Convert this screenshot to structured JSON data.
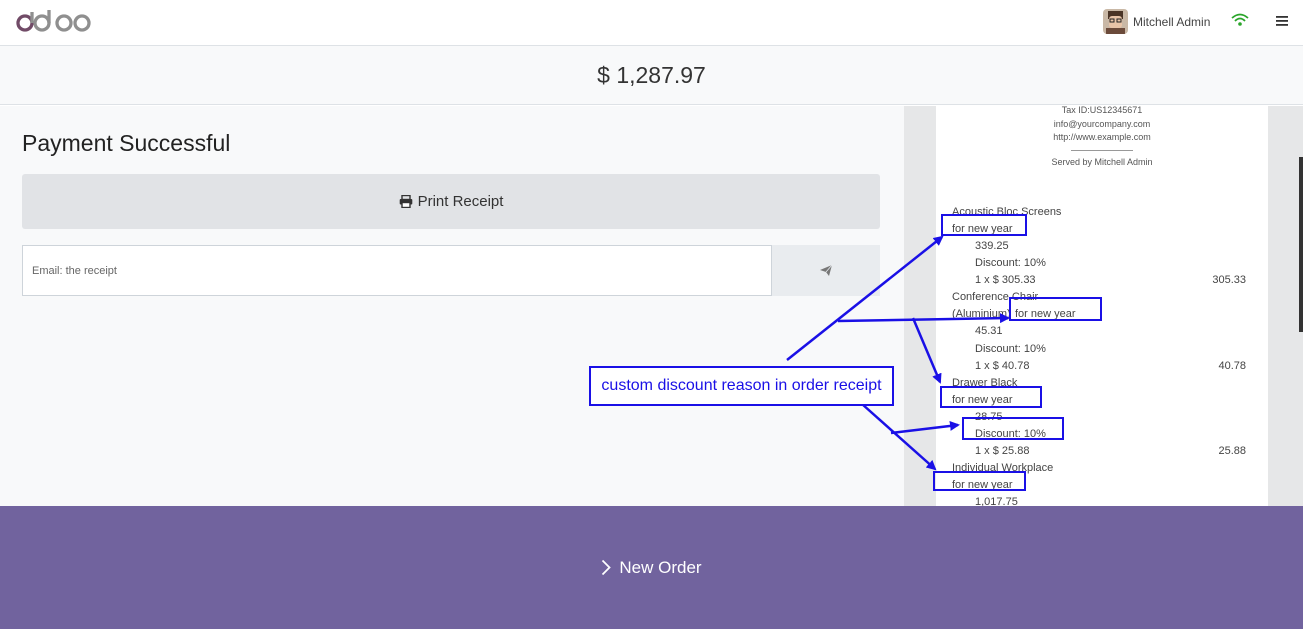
{
  "navbar": {
    "logo_text": "odoo",
    "user_name": "Mitchell Admin",
    "wifi_icon": "wifi-icon",
    "menu_icon": "hamburger-icon"
  },
  "total": "$ 1,287.97",
  "payment": {
    "title": "Payment Successful",
    "print_label": "Print Receipt",
    "email_placeholder": "Email: the receipt"
  },
  "receipt": {
    "header_lines": [
      "Tax ID:US12345671",
      "info@yourcompany.com",
      "http://www.example.com"
    ],
    "served_by": "Served by Mitchell Admin",
    "lines": [
      {
        "name": "Acoustic Bloc Screens",
        "note": "for new year",
        "unit": "339.25",
        "discount": "Discount: 10%",
        "qty": "1 x $ 305.33",
        "price": "305.33"
      },
      {
        "name": "Conference Chair",
        "name2": "(Aluminium)",
        "note": "for new year",
        "unit": "45.31",
        "discount": "Discount: 10%",
        "qty": "1 x $ 40.78",
        "price": "40.78"
      },
      {
        "name": "Drawer Black",
        "note": "for new year",
        "unit": "28.75",
        "discount": "Discount: 10%",
        "qty": "1 x $ 25.88",
        "price": "25.88"
      },
      {
        "name": "Individual Workplace",
        "note": "for new year",
        "unit": "1,017.75"
      }
    ]
  },
  "annotation": {
    "callout": "custom discount reason in order receipt",
    "color": "#1a10e6"
  },
  "new_order_label": "New Order",
  "colors": {
    "primary": "#71639e",
    "annotation": "#1a10e6"
  }
}
